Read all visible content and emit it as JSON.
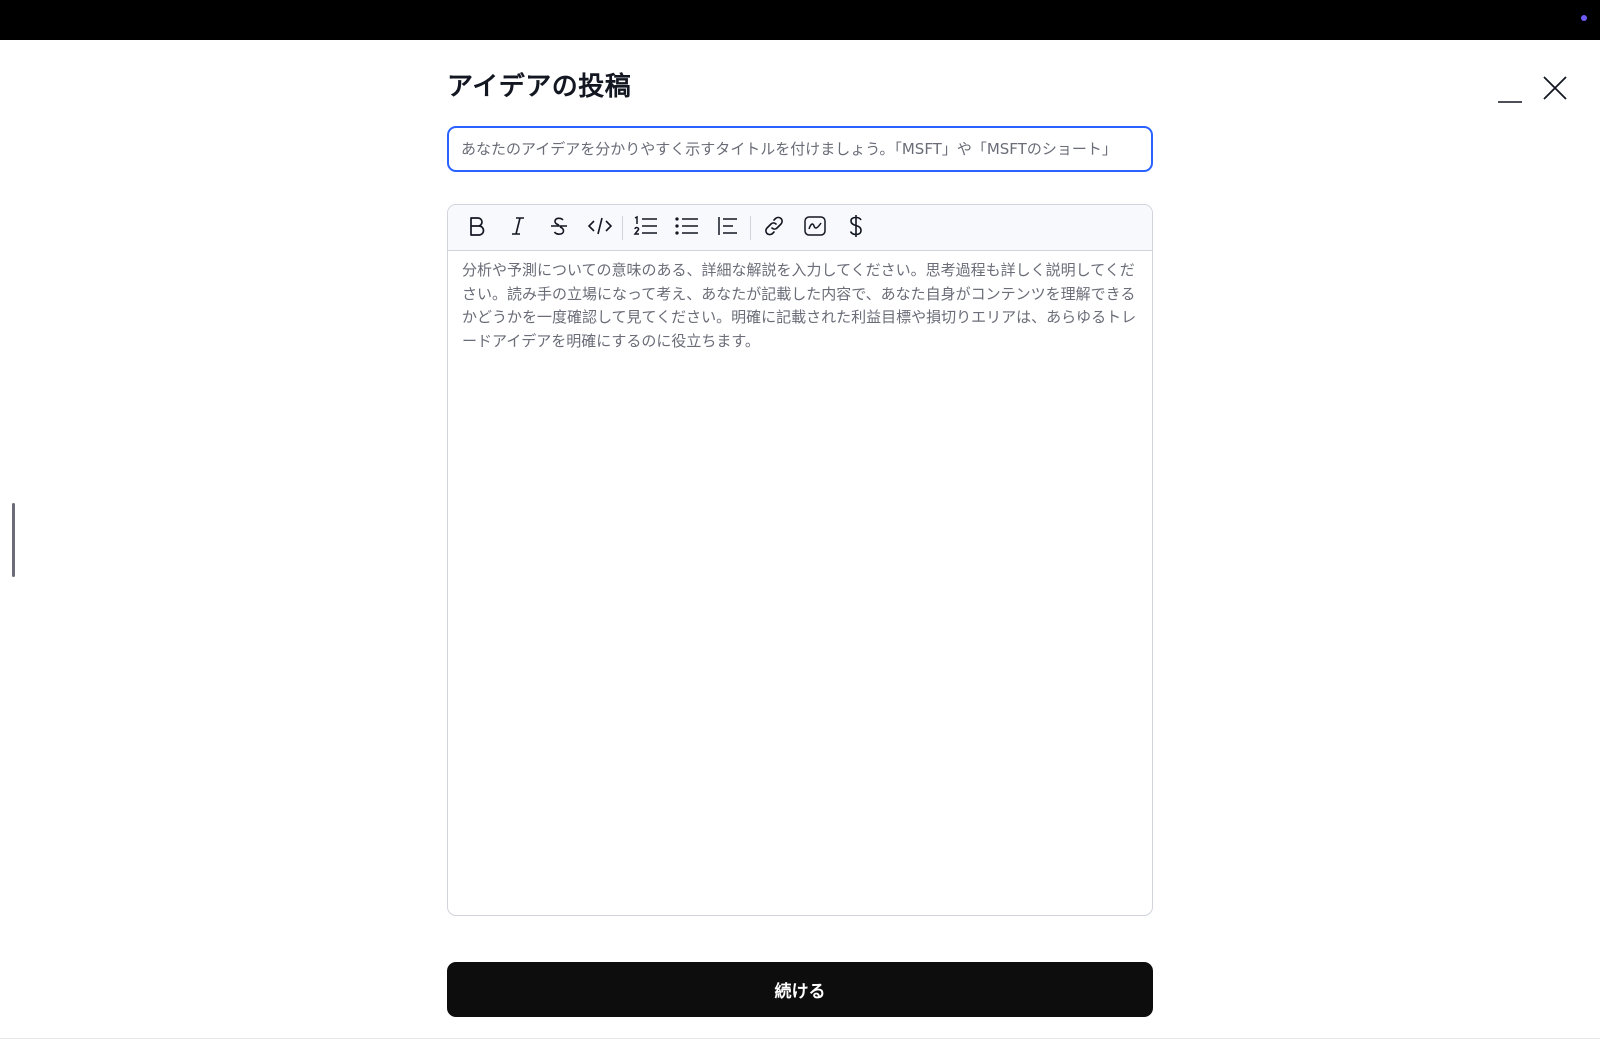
{
  "window": {
    "accent_dot_color": "#6f5cf5",
    "minimize_icon": "minimize-icon",
    "close_icon": "close-icon"
  },
  "modal": {
    "title": "アイデアの投稿",
    "title_input": {
      "value": "",
      "placeholder": "あなたのアイデアを分かりやすく示すタイトルを付けましょう。「MSFT」や「MSFTのショート」"
    },
    "toolbar": {
      "buttons": [
        {
          "name": "bold",
          "icon": "bold-icon"
        },
        {
          "name": "italic",
          "icon": "italic-icon"
        },
        {
          "name": "strikethrough",
          "icon": "strikethrough-icon"
        },
        {
          "name": "code",
          "icon": "code-icon"
        },
        {
          "name": "ordered-list",
          "icon": "ordered-list-icon"
        },
        {
          "name": "bullet-list",
          "icon": "bullet-list-icon"
        },
        {
          "name": "quote",
          "icon": "quote-icon"
        },
        {
          "name": "link",
          "icon": "link-icon"
        },
        {
          "name": "chart",
          "icon": "chart-icon"
        },
        {
          "name": "symbol",
          "icon": "dollar-icon"
        }
      ]
    },
    "body_placeholder": "分析や予測についての意味のある、詳細な解説を入力してください。思考過程も詳しく説明してください。読み手の立場になって考え、あなたが記載した内容で、あなた自身がコンテンツを理解できるかどうかを一度確認して見てください。明確に記載された利益目標や損切りエリアは、あらゆるトレードアイデアを明確にするのに役立ちます。",
    "continue_label": "続ける",
    "colors": {
      "focus_border": "#2962ff",
      "button_bg": "#0d0d0d",
      "placeholder_text": "#6a6d78"
    }
  }
}
